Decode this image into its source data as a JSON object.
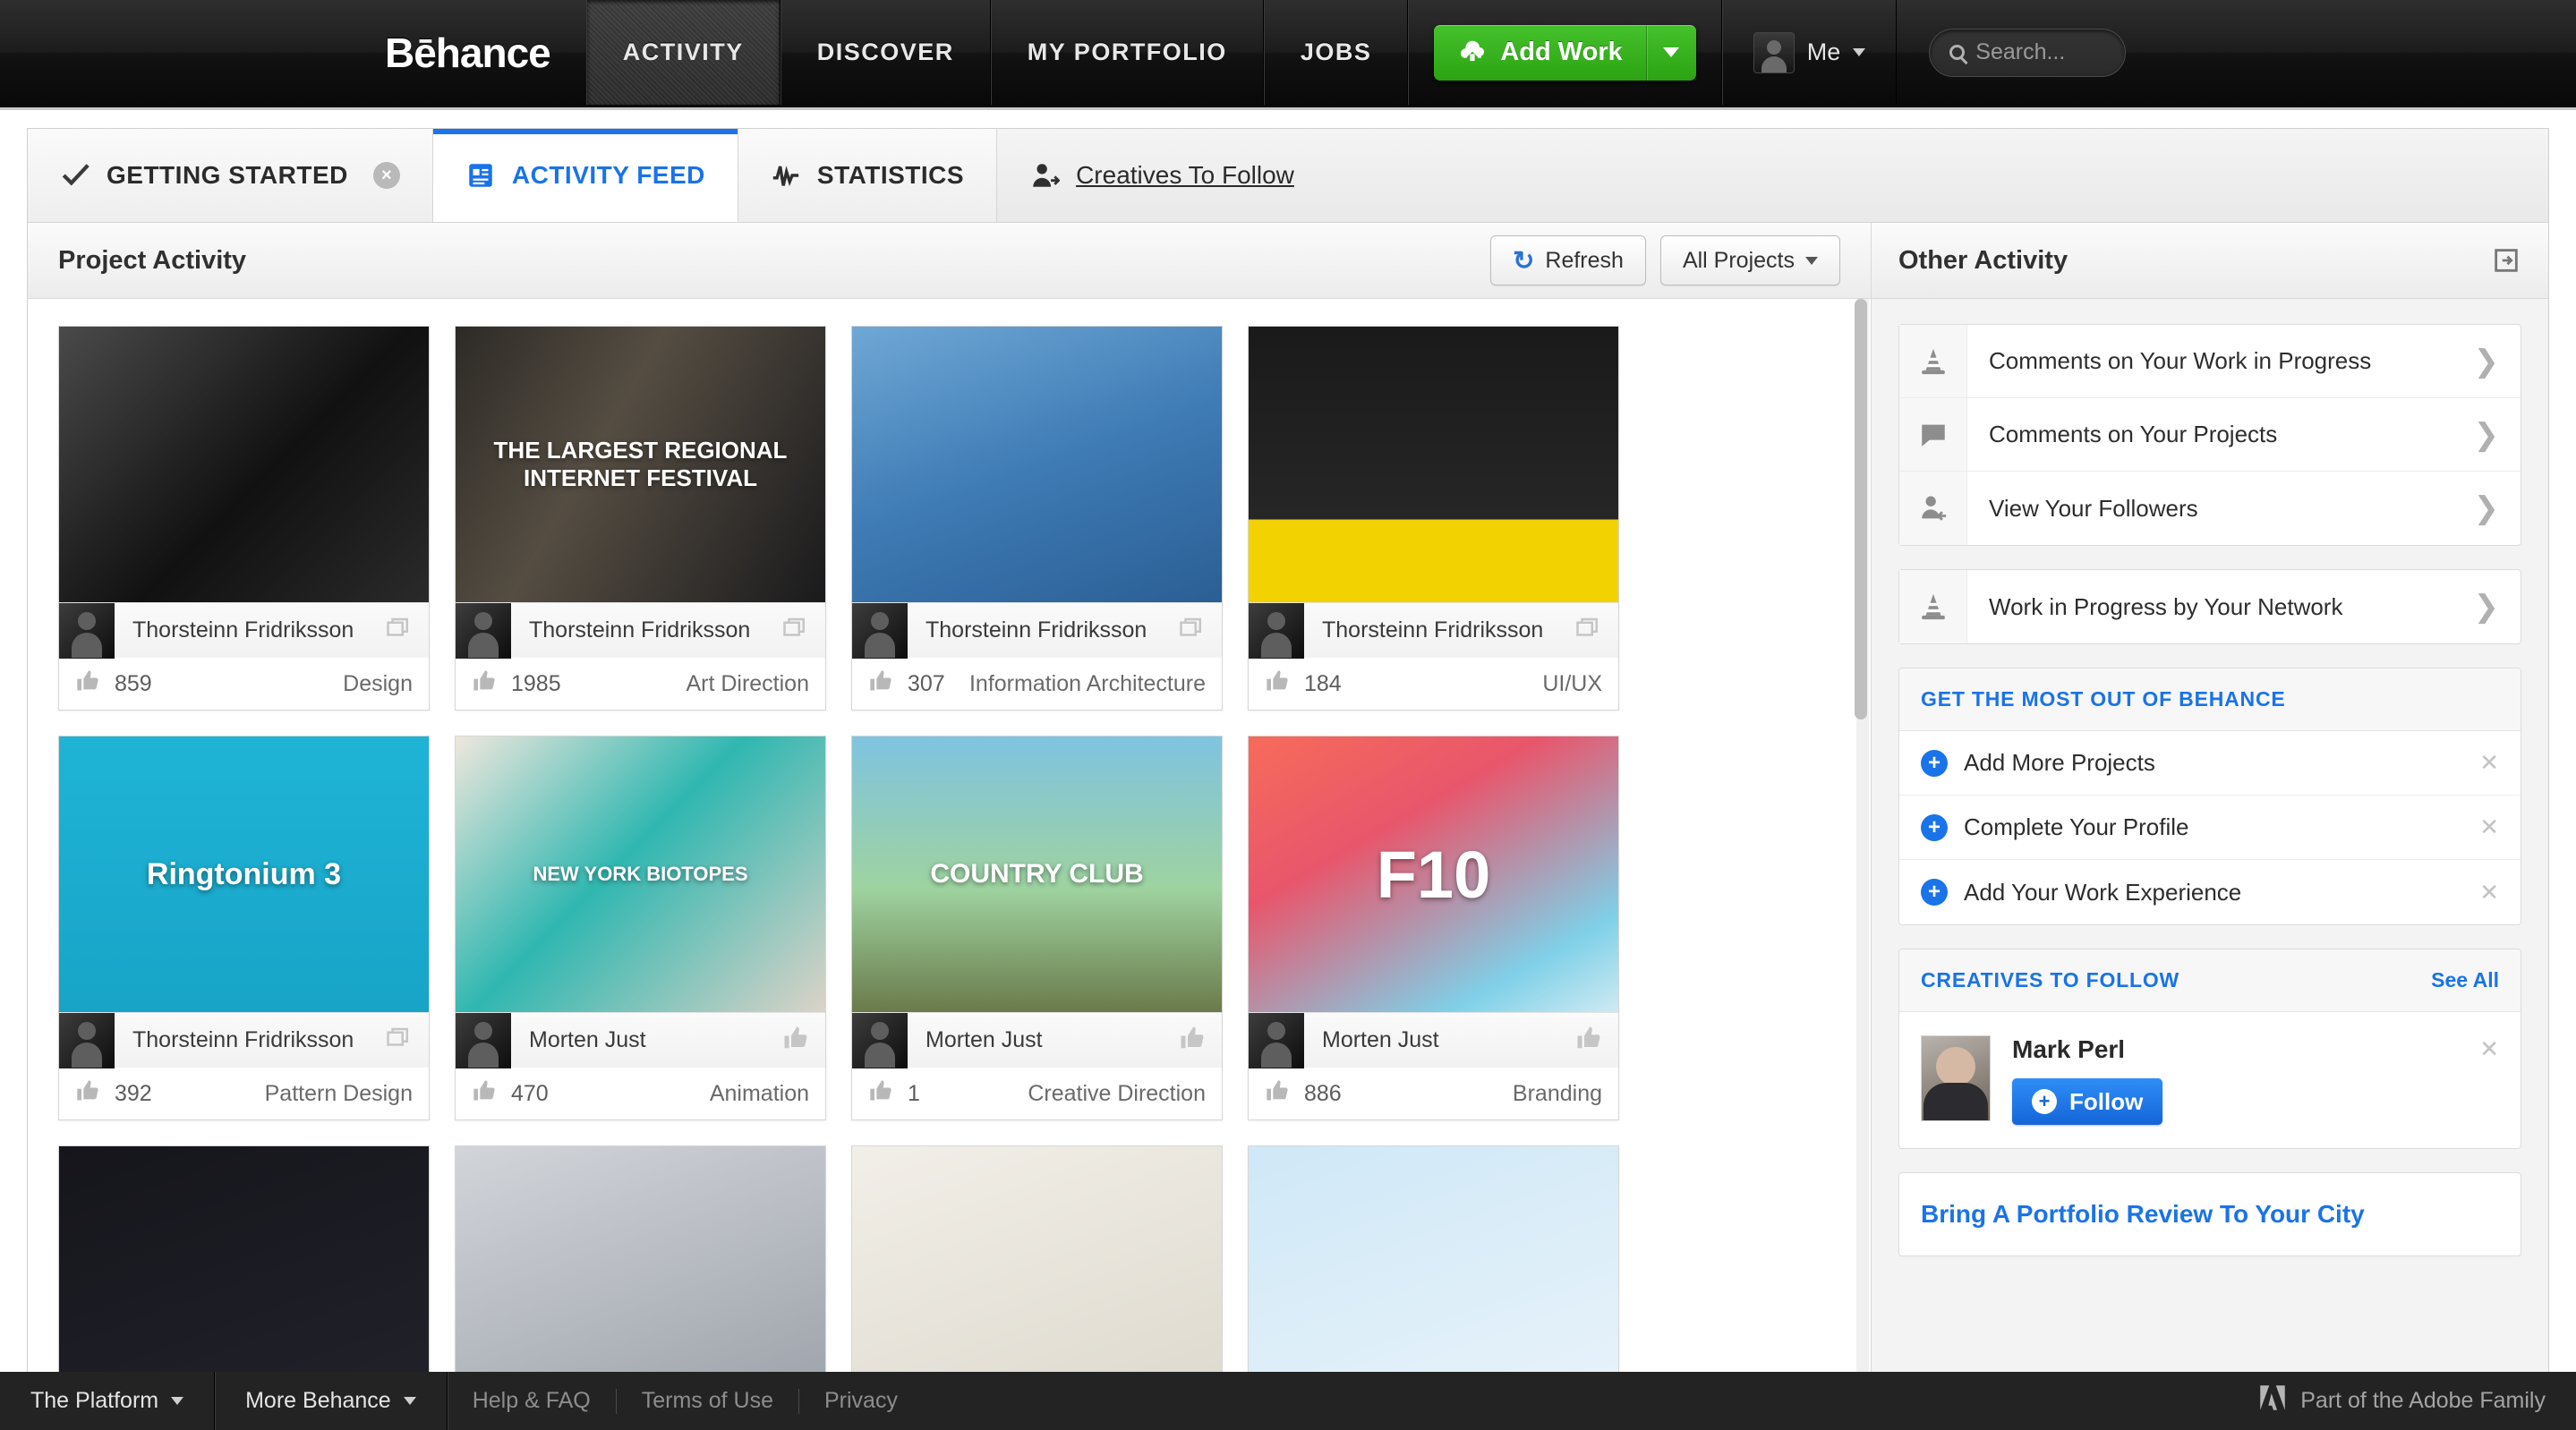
{
  "topnav": {
    "brand": "Bēhance",
    "tabs": [
      {
        "label": "ACTIVITY",
        "active": true
      },
      {
        "label": "DISCOVER",
        "active": false
      },
      {
        "label": "MY PORTFOLIO",
        "active": false
      },
      {
        "label": "JOBS",
        "active": false
      }
    ],
    "add_work_label": "Add Work",
    "add_work_icon": "cloud-upload-icon",
    "me_label": "Me",
    "search_placeholder": "Search...",
    "accent_green": "#35b51e"
  },
  "tabs": [
    {
      "label": "GETTING STARTED",
      "icon": "checkmark-icon",
      "active": false,
      "closable": true,
      "underline": false
    },
    {
      "label": "ACTIVITY FEED",
      "icon": "feed-icon",
      "active": true,
      "closable": false,
      "underline": false
    },
    {
      "label": "STATISTICS",
      "icon": "pulse-icon",
      "active": false,
      "closable": false,
      "underline": false
    },
    {
      "label": "Creatives To Follow",
      "icon": "person-add-icon",
      "active": false,
      "closable": false,
      "underline": true
    }
  ],
  "toolbar": {
    "title": "Project Activity",
    "refresh_label": "Refresh",
    "refresh_icon": "refresh-icon",
    "filter_label": "All Projects",
    "filter_icon": "chevron-down-icon"
  },
  "projects": [
    {
      "owner": "Thorsteinn Fridriksson",
      "likes": "859",
      "field": "Design",
      "owner_icon": "multi-image-icon",
      "cover_text": "",
      "bg": "linear-gradient(135deg,#4a4a4a 0%,#111 55%,#2a2a2a 100%)",
      "text_size": "0px"
    },
    {
      "owner": "Thorsteinn Fridriksson",
      "likes": "1985",
      "field": "Art Direction",
      "owner_icon": "multi-image-icon",
      "cover_text": "THE LARGEST REGIONAL INTERNET FESTIVAL",
      "bg": "linear-gradient(120deg,#2d2a26,#554d42 40%,#1a1a1c)",
      "text_size": "26px"
    },
    {
      "owner": "Thorsteinn Fridriksson",
      "likes": "307",
      "field": "Information Architecture",
      "owner_icon": "multi-image-icon",
      "cover_text": "",
      "bg": "linear-gradient(160deg,#6fa8d6,#3f7bb5 50%,#2a5f94)",
      "text_size": "0px"
    },
    {
      "owner": "Thorsteinn Fridriksson",
      "likes": "184",
      "field": "UI/UX",
      "owner_icon": "multi-image-icon",
      "cover_text": "",
      "bg": "linear-gradient(180deg,#1a1a1a 0%,#262626 70%,#f2d200 70%,#f2d200 100%)",
      "text_size": "0px"
    },
    {
      "owner": "Thorsteinn Fridriksson",
      "likes": "392",
      "field": "Pattern Design",
      "owner_icon": "multi-image-icon",
      "cover_text": "Ringtonium 3",
      "bg": "linear-gradient(180deg,#1fb4d6,#17a4c7)",
      "text_size": "34px"
    },
    {
      "owner": "Morten Just",
      "likes": "470",
      "field": "Animation",
      "owner_icon": "thumbs-up-icon",
      "cover_text": "NEW YORK BIOTOPES",
      "bg": "linear-gradient(135deg,#efe7dd,#2fb7b0 45%,#dcd3c8)",
      "text_size": "22px"
    },
    {
      "owner": "Morten Just",
      "likes": "1",
      "field": "Creative Direction",
      "owner_icon": "thumbs-up-icon",
      "cover_text": "COUNTRY CLUB",
      "bg": "linear-gradient(180deg,#7fc3e0 0%,#9ed3a0 55%,#6b7a4a 100%)",
      "text_size": "30px"
    },
    {
      "owner": "Morten Just",
      "likes": "886",
      "field": "Branding",
      "owner_icon": "thumbs-up-icon",
      "cover_text": "F10",
      "bg": "linear-gradient(150deg,#f76b5a,#e8566c 35%,#7fd0e8 80%,#cfeaf2)",
      "text_size": "74px"
    }
  ],
  "partial_row": [
    {
      "bg": "linear-gradient(160deg,#15151b,#22222c)"
    },
    {
      "bg": "linear-gradient(160deg,#d2d5da,#9aa0a8)"
    },
    {
      "bg": "linear-gradient(160deg,#f2efe8,#dcd8cd)"
    },
    {
      "bg": "linear-gradient(160deg,#cfe8f7,#e9f3fa)"
    }
  ],
  "sidebar": {
    "title": "Other Activity",
    "expand_icon": "expand-panel-icon",
    "activity_group_a": [
      {
        "label": "Comments on Your Work in Progress",
        "icon": "cone-icon"
      },
      {
        "label": "Comments on Your Projects",
        "icon": "comment-icon"
      },
      {
        "label": "View Your Followers",
        "icon": "person-arrow-icon"
      }
    ],
    "activity_group_b": [
      {
        "label": "Work in Progress by Your Network",
        "icon": "cone-icon"
      }
    ],
    "get_most": {
      "title": "GET THE MOST OUT OF BEHANCE",
      "items": [
        {
          "label": "Add More Projects",
          "icon": "plus-circle-icon",
          "close_icon": "close-icon"
        },
        {
          "label": "Complete Your Profile",
          "icon": "plus-circle-icon",
          "close_icon": "close-icon"
        },
        {
          "label": "Add Your Work Experience",
          "icon": "plus-circle-icon",
          "close_icon": "close-icon"
        }
      ]
    },
    "creatives": {
      "title": "CREATIVES TO FOLLOW",
      "see_all": "See All",
      "person_name": "Mark Perl",
      "follow_label": "Follow",
      "follow_icon": "plus-circle-icon",
      "close_icon": "close-icon"
    },
    "promo_title": "Bring A Portfolio Review To Your City"
  },
  "footer": {
    "platform_label": "The Platform",
    "more_label": "More Behance",
    "links": [
      "Help & FAQ",
      "Terms of Use",
      "Privacy"
    ],
    "adobe_text": "Part of the Adobe Family",
    "adobe_icon": "adobe-logo-icon"
  }
}
